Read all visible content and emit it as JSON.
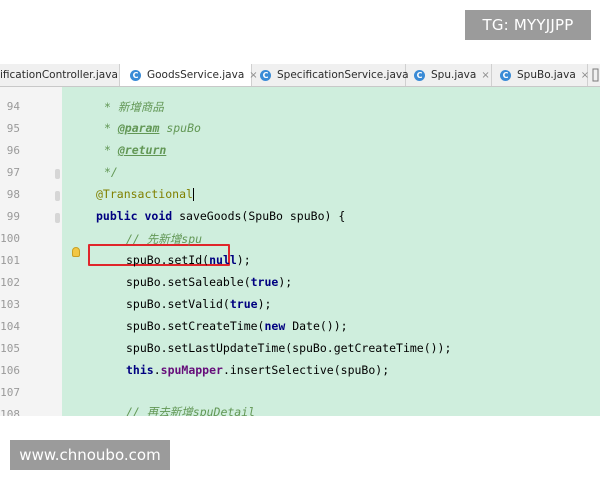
{
  "watermark": {
    "top": "TG: MYYJJPP",
    "bottom": "www.chnoubo.com"
  },
  "tabs": [
    {
      "label": "ificationController.java",
      "active": false
    },
    {
      "label": "GoodsService.java",
      "active": true
    },
    {
      "label": "SpecificationService.java",
      "active": false
    },
    {
      "label": "Spu.java",
      "active": false
    },
    {
      "label": "SpuBo.java",
      "active": false
    }
  ],
  "tab_close_glyph": "×",
  "tab_file_icon": "C",
  "line_numbers": [
    "94",
    "95",
    "96",
    "97",
    "98",
    "99",
    "100",
    "101",
    "102",
    "103",
    "104",
    "105",
    "106",
    "107",
    "108"
  ],
  "code": {
    "l94": "* 新增商品",
    "l95_tag": "@param",
    "l95_rest": " spuBo",
    "l96_tag": "@return",
    "l97": "*/",
    "l98": "@Transactional",
    "l99_kw1": "public",
    "l99_kw2": "void",
    "l99_rest": " saveGoods(SpuBo spuBo) {",
    "l100": "// 先新增spu",
    "l101_a": "spuBo.setId(",
    "l101_kw": "null",
    "l101_b": ");",
    "l102_a": "spuBo.setSaleable(",
    "l102_kw": "true",
    "l102_b": ");",
    "l103_a": "spuBo.setValid(",
    "l103_kw": "true",
    "l103_b": ");",
    "l104_a": "spuBo.setCreateTime(",
    "l104_kw": "new",
    "l104_b": " Date());",
    "l105": "spuBo.setLastUpdateTime(spuBo.getCreateTime());",
    "l106_kw": "this",
    "l106_dot": ".",
    "l106_fld": "spuMapper",
    "l106_rest": ".insertSelective(spuBo);",
    "l108": "// 再去新增spuDetail"
  },
  "colors": {
    "code_background": "#cfeedd",
    "gutter_background": "#f4f4f4",
    "highlight_box": "#e0262b",
    "comment": "#629755",
    "keyword": "#000080",
    "annotation": "#808000",
    "field": "#660e7a"
  },
  "icons": [
    "java-class-icon",
    "close-icon",
    "lightbulb-icon",
    "tab-overflow-icon"
  ]
}
